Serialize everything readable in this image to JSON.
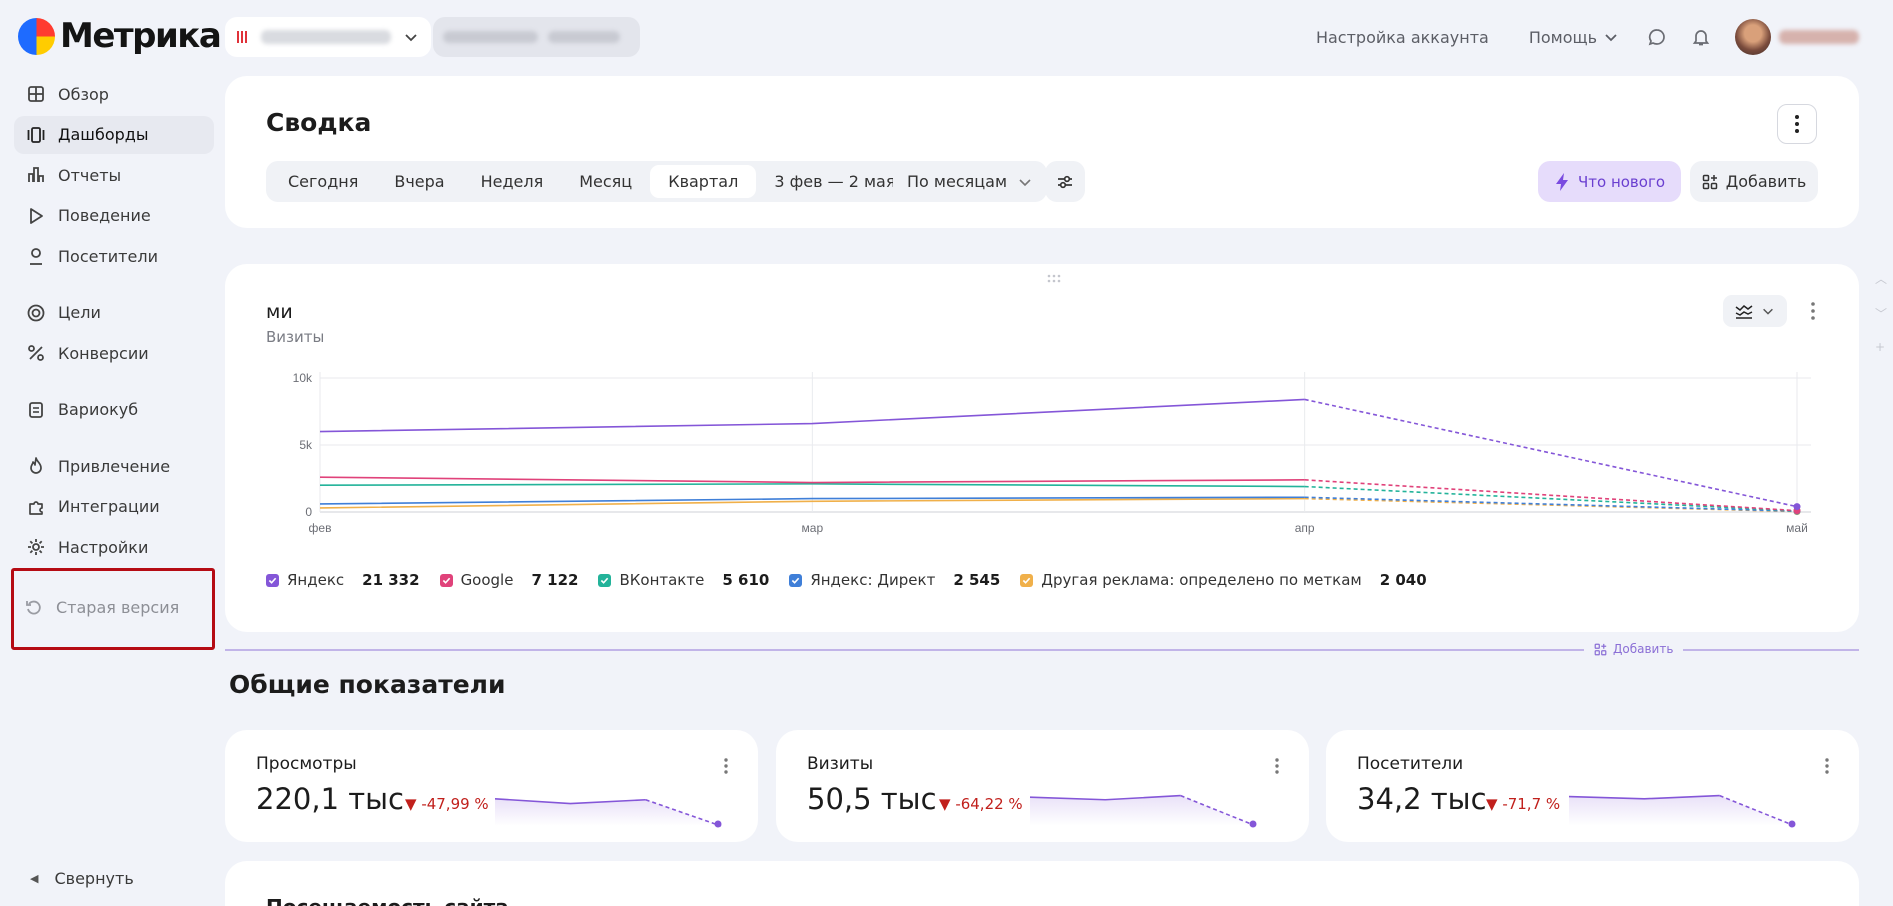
{
  "app": {
    "name": "Метрика",
    "logo_icon": "yandex-metrica-logo"
  },
  "sidebar": {
    "items": [
      {
        "label": "Обзор",
        "icon": "grid-icon",
        "active": false
      },
      {
        "label": "Дашборды",
        "icon": "dashboards-icon",
        "active": true
      },
      {
        "label": "Отчеты",
        "icon": "bar-chart-icon",
        "active": false
      },
      {
        "label": "Поведение",
        "icon": "play-icon",
        "active": false
      },
      {
        "label": "Посетители",
        "icon": "user-icon",
        "active": false
      },
      {
        "label": "Цели",
        "icon": "target-icon",
        "active": false
      },
      {
        "label": "Конверсии",
        "icon": "percent-icon",
        "active": false
      },
      {
        "label": "Вариокуб",
        "icon": "cube-icon",
        "active": false
      },
      {
        "label": "Привлечение",
        "icon": "fire-icon",
        "active": false
      },
      {
        "label": "Интеграции",
        "icon": "puzzle-icon",
        "active": false
      },
      {
        "label": "Настройки",
        "icon": "gear-icon",
        "active": false
      }
    ],
    "old_version": "Старая версия",
    "collapse": "Свернуть"
  },
  "topbar": {
    "account_settings": "Настройка аккаунта",
    "help": "Помощь",
    "chat_icon": "chat-icon",
    "bell_icon": "bell-icon"
  },
  "summary": {
    "title": "Сводка",
    "periods": [
      "Сегодня",
      "Вчера",
      "Неделя",
      "Месяц",
      "Квартал"
    ],
    "active_period": "Квартал",
    "date_range": "3 фев — 2 мая",
    "grouping": "По месяцам",
    "whats_new": "Что нового",
    "add": "Добавить"
  },
  "widget": {
    "title": "ми",
    "subtitle": "Визиты",
    "chart_data": {
      "type": "line",
      "x": [
        "фев",
        "мар",
        "апр",
        "май"
      ],
      "ylim": [
        0,
        10000
      ],
      "yticks": [
        "0",
        "5k",
        "10k"
      ],
      "grid": true,
      "legend_position": "bottom",
      "dashed_last_segment": true,
      "series": [
        {
          "name": "Яндекс",
          "total": "21 332",
          "color": "#8456d8",
          "values": [
            6000,
            6600,
            8400,
            400
          ]
        },
        {
          "name": "Google",
          "total": "7 122",
          "color": "#e0427a",
          "values": [
            2600,
            2200,
            2400,
            100
          ]
        },
        {
          "name": "ВКонтакте",
          "total": "5 610",
          "color": "#23b39a",
          "values": [
            2000,
            2100,
            1900,
            80
          ]
        },
        {
          "name": "Яндекс: Директ",
          "total": "2 545",
          "color": "#3f7fd8",
          "values": [
            600,
            1000,
            1100,
            60
          ]
        },
        {
          "name": "Другая реклама: определено по меткам",
          "total": "2 040",
          "color": "#f0b04a",
          "values": [
            300,
            800,
            1000,
            30
          ]
        }
      ]
    }
  },
  "divider_add": "Добавить",
  "section_title": "Общие показатели",
  "metrics": [
    {
      "label": "Просмотры",
      "value": "220,1 тыс",
      "delta": "-47,99 %",
      "spark": [
        0.85,
        0.7,
        0.82,
        0.0
      ]
    },
    {
      "label": "Визиты",
      "value": "50,5 тыс",
      "delta": "-64,22 %",
      "spark": [
        0.9,
        0.82,
        0.95,
        0.0
      ]
    },
    {
      "label": "Посетители",
      "value": "34,2 тыс",
      "delta": "-71,7 %",
      "spark": [
        0.92,
        0.85,
        0.95,
        0.0
      ]
    }
  ],
  "bottom_card_title": "Посещаемость сайта",
  "colors": {
    "accent": "#8456d8",
    "negative": "#c1201c",
    "highlight_box": "#b50b14"
  }
}
